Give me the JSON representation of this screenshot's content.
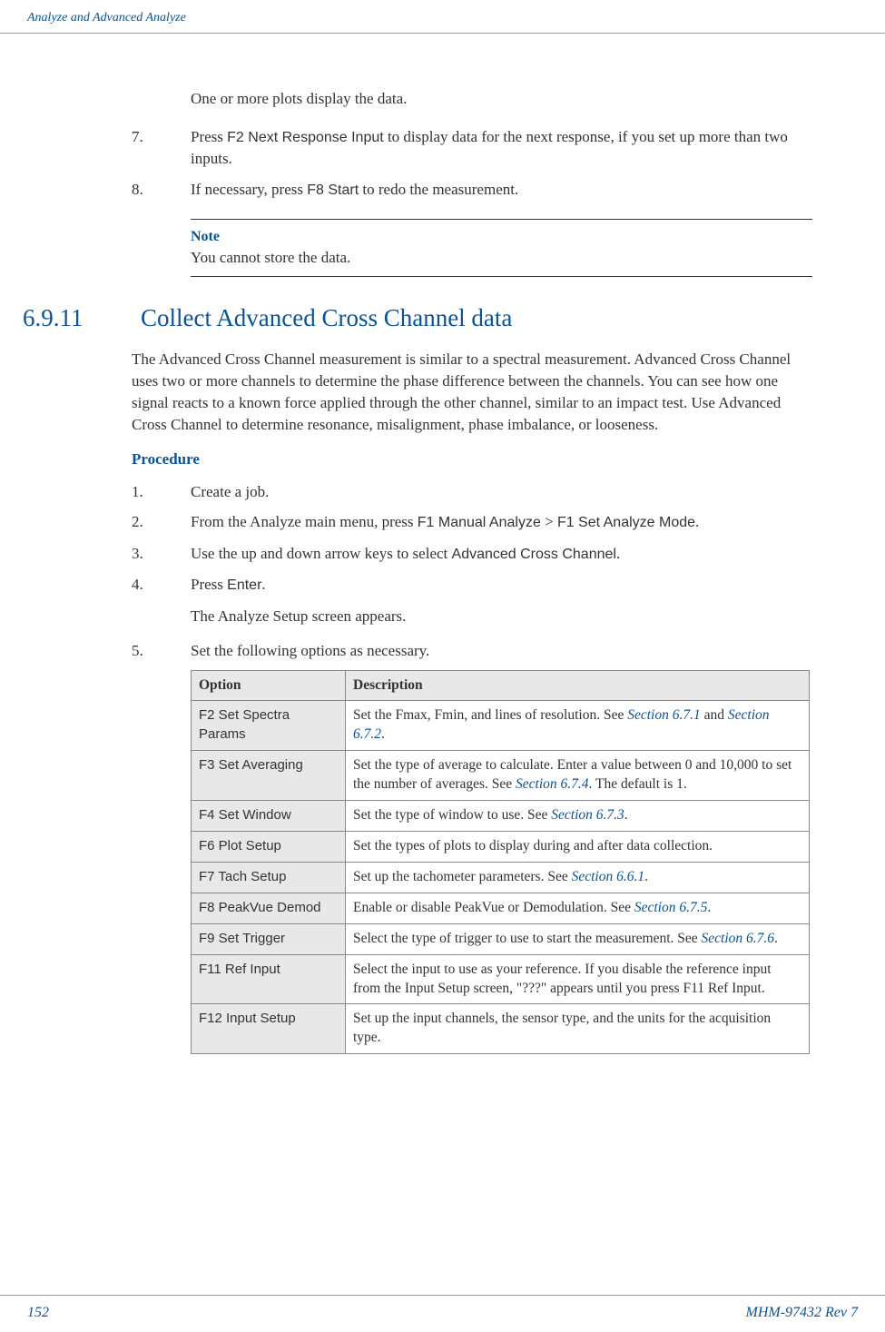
{
  "header": {
    "title": "Analyze and Advanced Analyze"
  },
  "intro_text": "One or more plots display the data.",
  "top_steps": [
    {
      "num": "7.",
      "pre": "Press ",
      "ui": "F2 Next Response Input",
      "post": " to display data for the next response, if you set up more than two inputs."
    },
    {
      "num": "8.",
      "pre": "If necessary, press ",
      "ui": "F8 Start",
      "post": " to redo the measurement."
    }
  ],
  "note": {
    "label": "Note",
    "text": "You cannot store the data."
  },
  "section": {
    "num": "6.9.11",
    "title": "Collect Advanced Cross Channel data",
    "para": "The Advanced Cross Channel measurement is similar to a spectral measurement. Advanced Cross Channel uses two or more channels to determine the phase difference between the channels. You can see how one signal reacts to a known force applied through the other channel, similar to an impact test. Use Advanced Cross Channel to determine resonance, misalignment, phase imbalance, or looseness."
  },
  "procedure_label": "Procedure",
  "proc_steps": {
    "s1": {
      "num": "1.",
      "text": "Create a job."
    },
    "s2": {
      "num": "2.",
      "pre": "From the Analyze main menu, press ",
      "ui1": "F1 Manual Analyze",
      "mid": " > ",
      "ui2": "F1 Set Analyze Mode",
      "post": "."
    },
    "s3": {
      "num": "3.",
      "pre": "Use the up and down arrow keys to select ",
      "ui": "Advanced Cross Channel",
      "post": "."
    },
    "s4": {
      "num": "4.",
      "pre": "Press ",
      "ui": "Enter",
      "post": "."
    },
    "s4_sub": "The Analyze Setup screen appears.",
    "s5": {
      "num": "5.",
      "text": "Set the following options as necessary."
    }
  },
  "table": {
    "h1": "Option",
    "h2": "Description",
    "rows": [
      {
        "opt": "F2 Set Spectra Params",
        "d1": "Set the Fmax, Fmin, and lines of resolution. See ",
        "l1": "Section 6.7.1",
        "d2": " and ",
        "l2": "Section 6.7.2",
        "d3": "."
      },
      {
        "opt": "F3 Set Averaging",
        "d1": "Set the type of average to calculate. Enter a value between 0 and 10,000 to set the number of averages. See ",
        "l1": "Section 6.7.4",
        "d2": ". The default is 1."
      },
      {
        "opt": "F4 Set Window",
        "d1": "Set the type of window to use. See ",
        "l1": "Section 6.7.3",
        "d2": "."
      },
      {
        "opt": "F6 Plot Setup",
        "d1": "Set the types of plots to display during and after data collection."
      },
      {
        "opt": "F7 Tach Setup",
        "d1": "Set up the tachometer parameters. See ",
        "l1": "Section 6.6.1",
        "d2": "."
      },
      {
        "opt": "F8 PeakVue Demod",
        "d1": "Enable or disable PeakVue or Demodulation. See ",
        "l1": "Section 6.7.5",
        "d2": "."
      },
      {
        "opt": "F9 Set Trigger",
        "d1": "Select the type of trigger to use to start the measurement. See ",
        "l1": "Section 6.7.6",
        "d2": "."
      },
      {
        "opt": "F11 Ref Input",
        "d1": "Select the input to use as your reference. If you disable the reference input from the Input Setup screen, \"???\" appears until you press F11 Ref Input."
      },
      {
        "opt": "F12 Input Setup",
        "d1": "Set up the input channels, the sensor type, and the units for the acquisition type."
      }
    ]
  },
  "footer": {
    "page": "152",
    "docid": "MHM-97432 Rev 7"
  }
}
